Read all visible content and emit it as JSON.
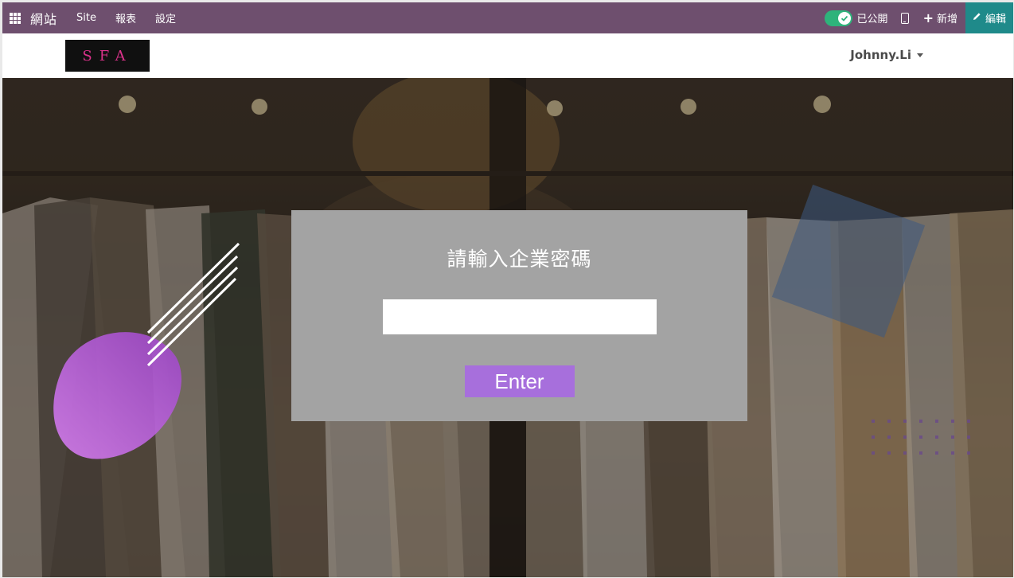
{
  "adminbar": {
    "brand": "網站",
    "menu": [
      "Site",
      "報表",
      "設定"
    ],
    "published_label": "已公開",
    "new_label": "新增",
    "edit_label": "編輯",
    "icons": [
      "apps-icon",
      "check-icon",
      "mobile-icon",
      "plus-icon",
      "pencil-icon"
    ],
    "colors": {
      "bar": "#6e4f6e",
      "toggle": "#2eb37b",
      "edit": "#1f8a8a"
    },
    "published": true
  },
  "header": {
    "logo_text": "SFA",
    "user_name": "Johnny.Li"
  },
  "login": {
    "title": "請輸入企業密碼",
    "password_value": "",
    "enter_label": "Enter",
    "colors": {
      "box": "#a3a3a3",
      "button": "#a76fdc"
    }
  }
}
